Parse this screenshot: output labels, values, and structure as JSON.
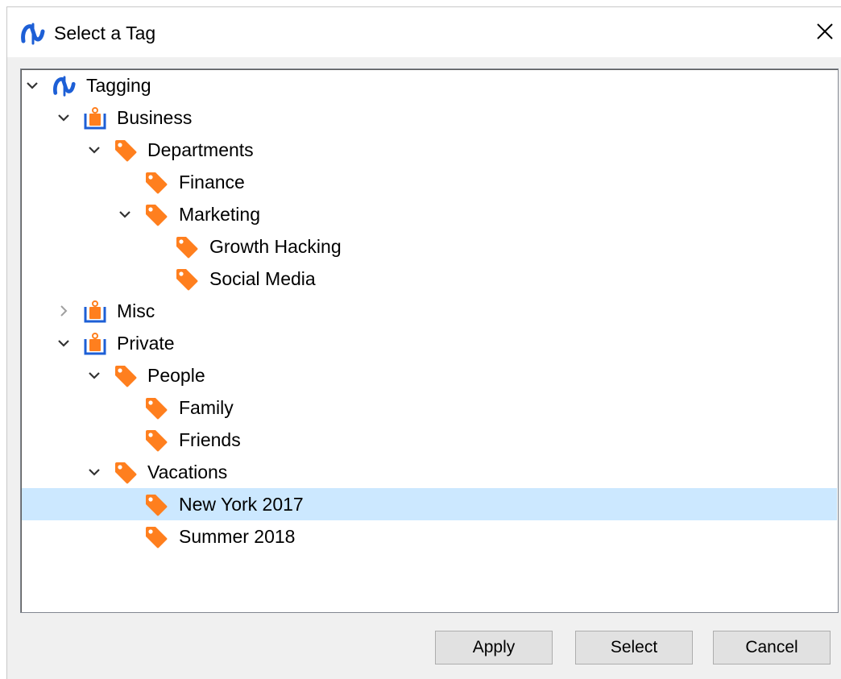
{
  "window": {
    "title": "Select a Tag"
  },
  "colors": {
    "tag": "#ff7f1e",
    "brand": "#1d5fd6",
    "selection": "#cce8ff"
  },
  "tree": {
    "nodes": [
      {
        "label": "Tagging",
        "icon": "app-logo-icon",
        "expander": "expanded"
      },
      {
        "label": "Business",
        "icon": "tag-group-icon",
        "expander": "expanded"
      },
      {
        "label": "Departments",
        "icon": "tag-icon",
        "expander": "expanded"
      },
      {
        "label": "Finance",
        "icon": "tag-icon",
        "expander": "none"
      },
      {
        "label": "Marketing",
        "icon": "tag-icon",
        "expander": "expanded"
      },
      {
        "label": "Growth Hacking",
        "icon": "tag-icon",
        "expander": "none"
      },
      {
        "label": "Social Media",
        "icon": "tag-icon",
        "expander": "none"
      },
      {
        "label": "Misc",
        "icon": "tag-group-icon",
        "expander": "collapsed"
      },
      {
        "label": "Private",
        "icon": "tag-group-icon",
        "expander": "expanded"
      },
      {
        "label": "People",
        "icon": "tag-icon",
        "expander": "expanded"
      },
      {
        "label": "Family",
        "icon": "tag-icon",
        "expander": "none"
      },
      {
        "label": "Friends",
        "icon": "tag-icon",
        "expander": "none"
      },
      {
        "label": "Vacations",
        "icon": "tag-icon",
        "expander": "expanded"
      },
      {
        "label": "New York 2017",
        "icon": "tag-icon",
        "expander": "none",
        "selected": true
      },
      {
        "label": "Summer 2018",
        "icon": "tag-icon",
        "expander": "none"
      }
    ]
  },
  "buttons": {
    "apply": "Apply",
    "select": "Select",
    "cancel": "Cancel"
  }
}
